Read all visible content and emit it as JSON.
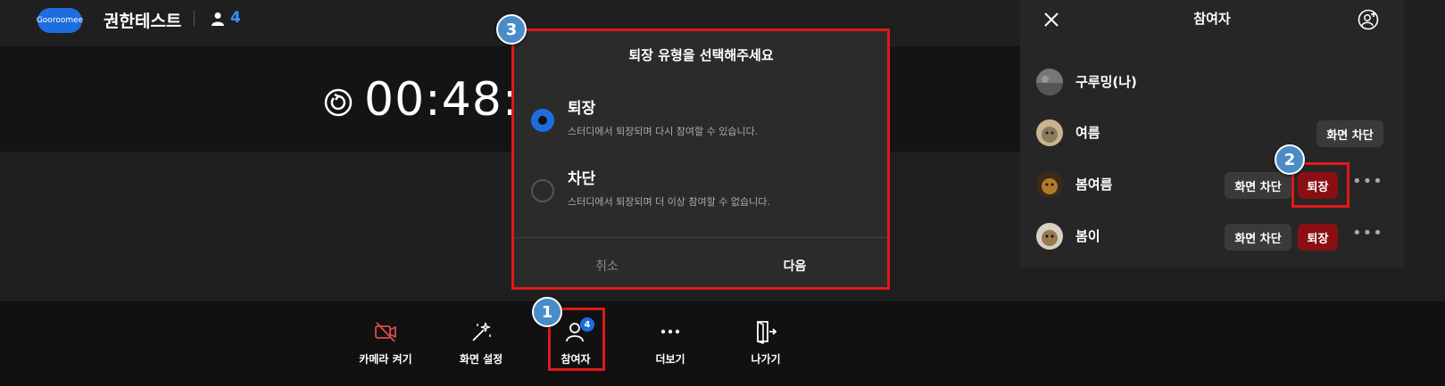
{
  "header": {
    "logo_text": "Gooroomee",
    "title": "권한테스트",
    "user_count": "4"
  },
  "timer": {
    "value": "00:48:4"
  },
  "toolbar": {
    "camera_label": "카메라 켜기",
    "screen_settings_label": "화면 설정",
    "participants_label": "참여자",
    "participants_badge": "4",
    "more_label": "더보기",
    "exit_label": "나가기"
  },
  "panel": {
    "title": "참여자",
    "participants": [
      {
        "name": "구루밍(나)"
      },
      {
        "name": "여름",
        "block_label": "화면 차단"
      },
      {
        "name": "봄여름",
        "block_label": "화면 차단",
        "kick_label": "퇴장"
      },
      {
        "name": "봄이",
        "block_label": "화면 차단",
        "kick_label": "퇴장"
      }
    ]
  },
  "modal": {
    "title": "퇴장 유형을 선택해주세요",
    "options": [
      {
        "title": "퇴장",
        "desc": "스터디에서 퇴장되며 다시 참여할 수 있습니다.",
        "selected": true
      },
      {
        "title": "차단",
        "desc": "스터디에서 퇴장되며 더 이상 참여할 수 없습니다.",
        "selected": false
      }
    ],
    "cancel_label": "취소",
    "next_label": "다음"
  },
  "annotations": {
    "marker1": "1",
    "marker2": "2",
    "marker3": "3"
  },
  "colors": {
    "accent_blue": "#1e6de0",
    "kick_red": "#8a0f12",
    "highlight_red": "#e01818",
    "marker_blue": "#4a8cc8"
  }
}
